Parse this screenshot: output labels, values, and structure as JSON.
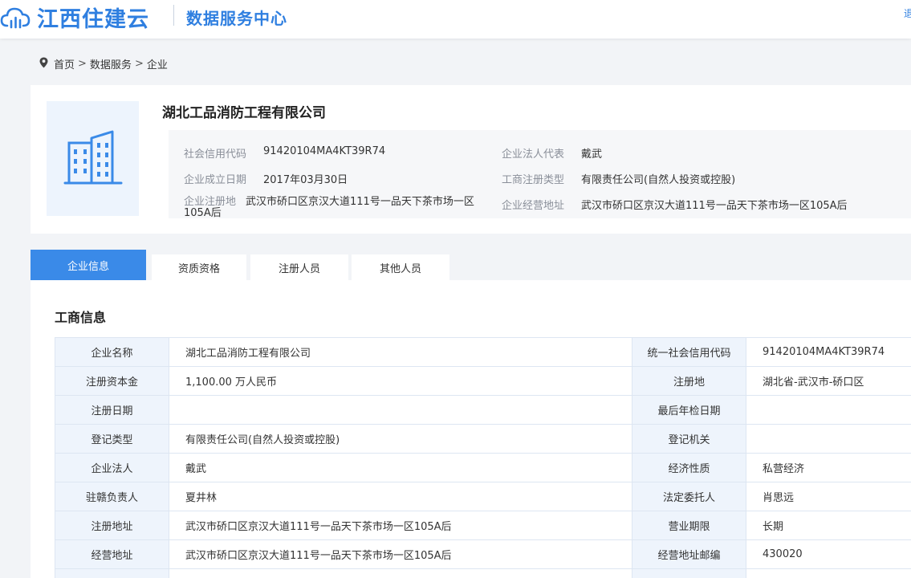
{
  "header": {
    "brand": "江西住建云",
    "subtitle": "数据服务中心",
    "link": "退"
  },
  "breadcrumb": {
    "items": [
      "首页",
      "数据服务",
      "企业"
    ],
    "separator": ">"
  },
  "company": {
    "name": "湖北工品消防工程有限公司",
    "credit_code_label": "社会信用代码",
    "credit_code": "91420104MA4KT39R74",
    "legal_rep_label": "企业法人代表",
    "legal_rep": "戴武",
    "founded_label": "企业成立日期",
    "founded": "2017年03月30日",
    "reg_type_label": "工商注册类型",
    "reg_type": "有限责任公司(自然人投资或控股)",
    "reg_addr_label": "企业注册地",
    "reg_addr": "武汉市硚口区京汉大道111号一品天下茶市场一区105A后",
    "biz_addr_label": "企业经营地址",
    "biz_addr": "武汉市硚口区京汉大道111号一品天下茶市场一区105A后"
  },
  "tabs": [
    {
      "label": "企业信息",
      "active": true
    },
    {
      "label": "资质资格",
      "active": false
    },
    {
      "label": "注册人员",
      "active": false
    },
    {
      "label": "其他人员",
      "active": false
    }
  ],
  "section": {
    "title": "工商信息"
  },
  "info_table": [
    [
      "企业名称",
      "湖北工品消防工程有限公司",
      "统一社会信用代码",
      "91420104MA4KT39R74"
    ],
    [
      "注册资本金",
      "1,100.00 万人民币",
      "注册地",
      "湖北省-武汉市-硚口区"
    ],
    [
      "注册日期",
      "",
      "最后年检日期",
      ""
    ],
    [
      "登记类型",
      "有限责任公司(自然人投资或控股)",
      "登记机关",
      ""
    ],
    [
      "企业法人",
      "戴武",
      "经济性质",
      "私营经济"
    ],
    [
      "驻赣负责人",
      "夏井林",
      "法定委托人",
      "肖思远"
    ],
    [
      "注册地址",
      "武汉市硚口区京汉大道111号一品天下茶市场一区105A后",
      "营业期限",
      "长期"
    ],
    [
      "经营地址",
      "武汉市硚口区京汉大道111号一品天下茶市场一区105A后",
      "经营地址邮编",
      "430020"
    ],
    [
      "",
      "",
      "",
      ""
    ]
  ],
  "colors": {
    "brand": "#2f7fe0",
    "tab_active": "#3a8ae8",
    "key_cell_bg": "#eef4fc",
    "icon_bg": "#edf4fd"
  },
  "icons": {
    "logo": "cloud-chart-icon",
    "breadcrumb": "location-pin-icon",
    "company": "building-icon"
  }
}
